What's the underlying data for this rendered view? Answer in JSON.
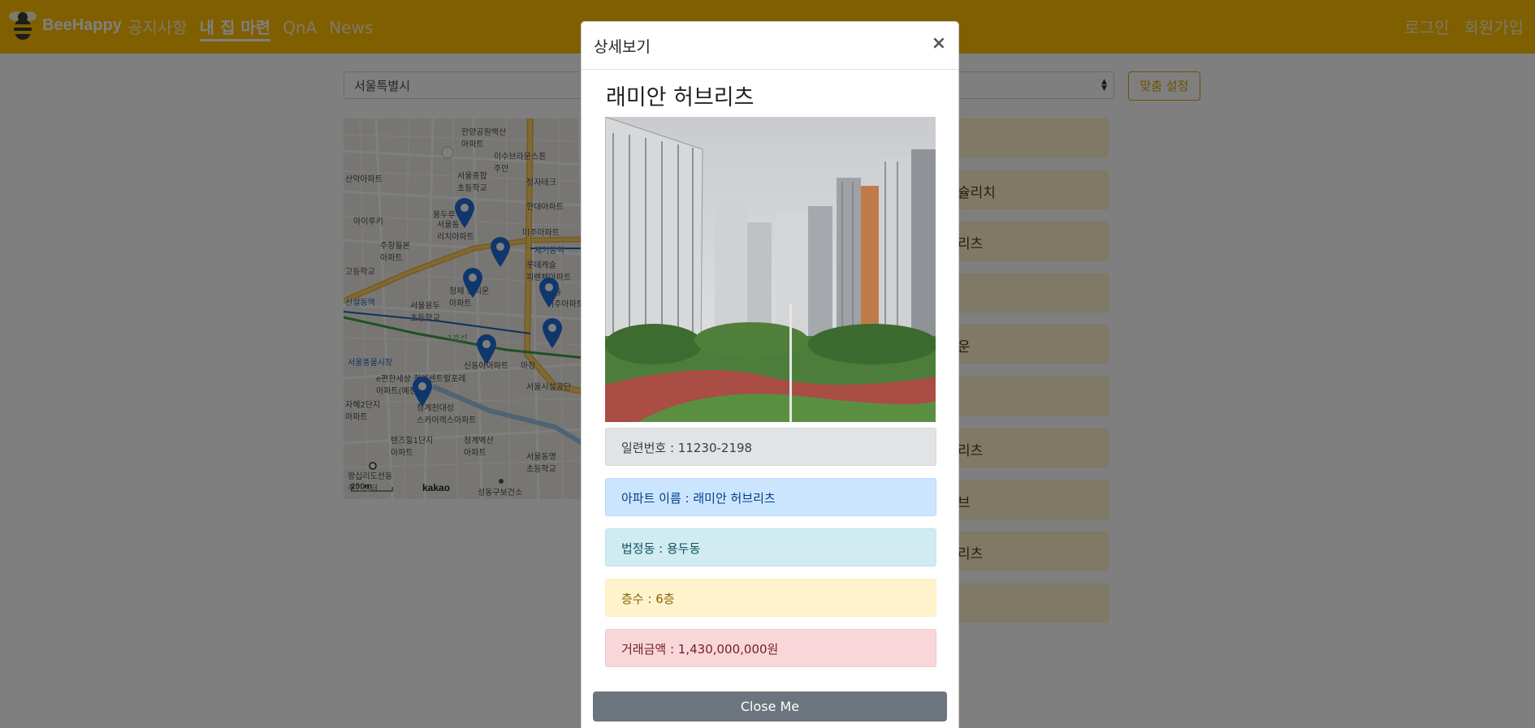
{
  "navbar": {
    "brand": "BeeHappy",
    "links": [
      "공지사항",
      "내 집 마련",
      "QnA",
      "News"
    ],
    "auth": [
      "로그인",
      "회원가입"
    ]
  },
  "filters": {
    "city": "서울특별시",
    "fit_button": "맞춤 설정"
  },
  "map": {
    "labels": [
      "한양공원백산\n아파트",
      "이수브라운스톤\n주안",
      "서울종합\n초등학교",
      "아이루키",
      "서울동\n리치아파트",
      "주항월본\n아파트",
      "용두루",
      "한대아파트",
      "정자테크",
      "미주아파트",
      "롯데캐슬\n피렌체아파트",
      "제기동역",
      "청재 홍티운\n아파트",
      "신설동역",
      "서울용두\n초등학교",
      "경동\n미주아파트",
      "서울풍물시장",
      "e편한세상 청계센트럴포레\n아파트(예정)",
      "신동아아파트",
      "마장",
      "서울시설공단",
      "청계천대성\n스카이렉스아파트",
      "텐즈힐1단지\n아파트",
      "청계벽산\n아파트",
      "서울동명\n초등학교",
      "왕십리도선동\n주민센터",
      "성동구보건소",
      "자혜2단지\n아파트",
      "산악아파트",
      "1호선",
      "고등학교"
    ],
    "scale": "250m",
    "logo": "kakao"
  },
  "list": [
    "",
    "슐리치",
    "리츠",
    "",
    "운",
    "",
    "리츠",
    "브",
    "리츠",
    ""
  ],
  "modal": {
    "title": "상세보기",
    "close_icon": "×",
    "apartment_name": "래미안 허브리츠",
    "serial": "일련번호 : 11230-2198",
    "name_line": "아파트 이름 : 래미안 허브리츠",
    "dong": "법정동 : 용두동",
    "floor": "층수 : 6층",
    "price": "거래금액 : 1,430,000,000원",
    "close_button": "Close Me"
  },
  "colors": {
    "navbar": "#ffbf00",
    "marker": "#1e6fd9"
  }
}
